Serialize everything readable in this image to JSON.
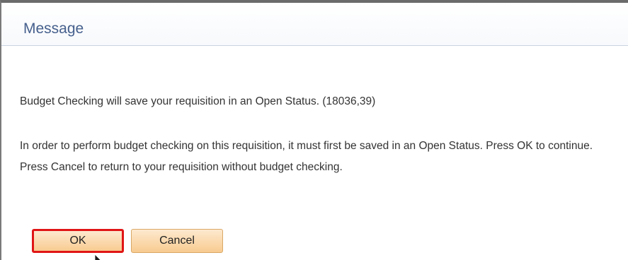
{
  "dialog": {
    "title": "Message",
    "line1": "Budget Checking will save your requisition in an Open Status. (18036,39)",
    "line2": "In order to perform budget checking on this requisition, it must first be saved in an Open Status.  Press OK to continue. Press Cancel to return to your requisition without budget checking.",
    "ok_label": "OK",
    "cancel_label": "Cancel"
  },
  "colors": {
    "title": "#46608d",
    "button_fill": "#f8cb90",
    "highlight": "#e01515"
  },
  "icons": {
    "pointer": "mouse-pointer-icon"
  }
}
